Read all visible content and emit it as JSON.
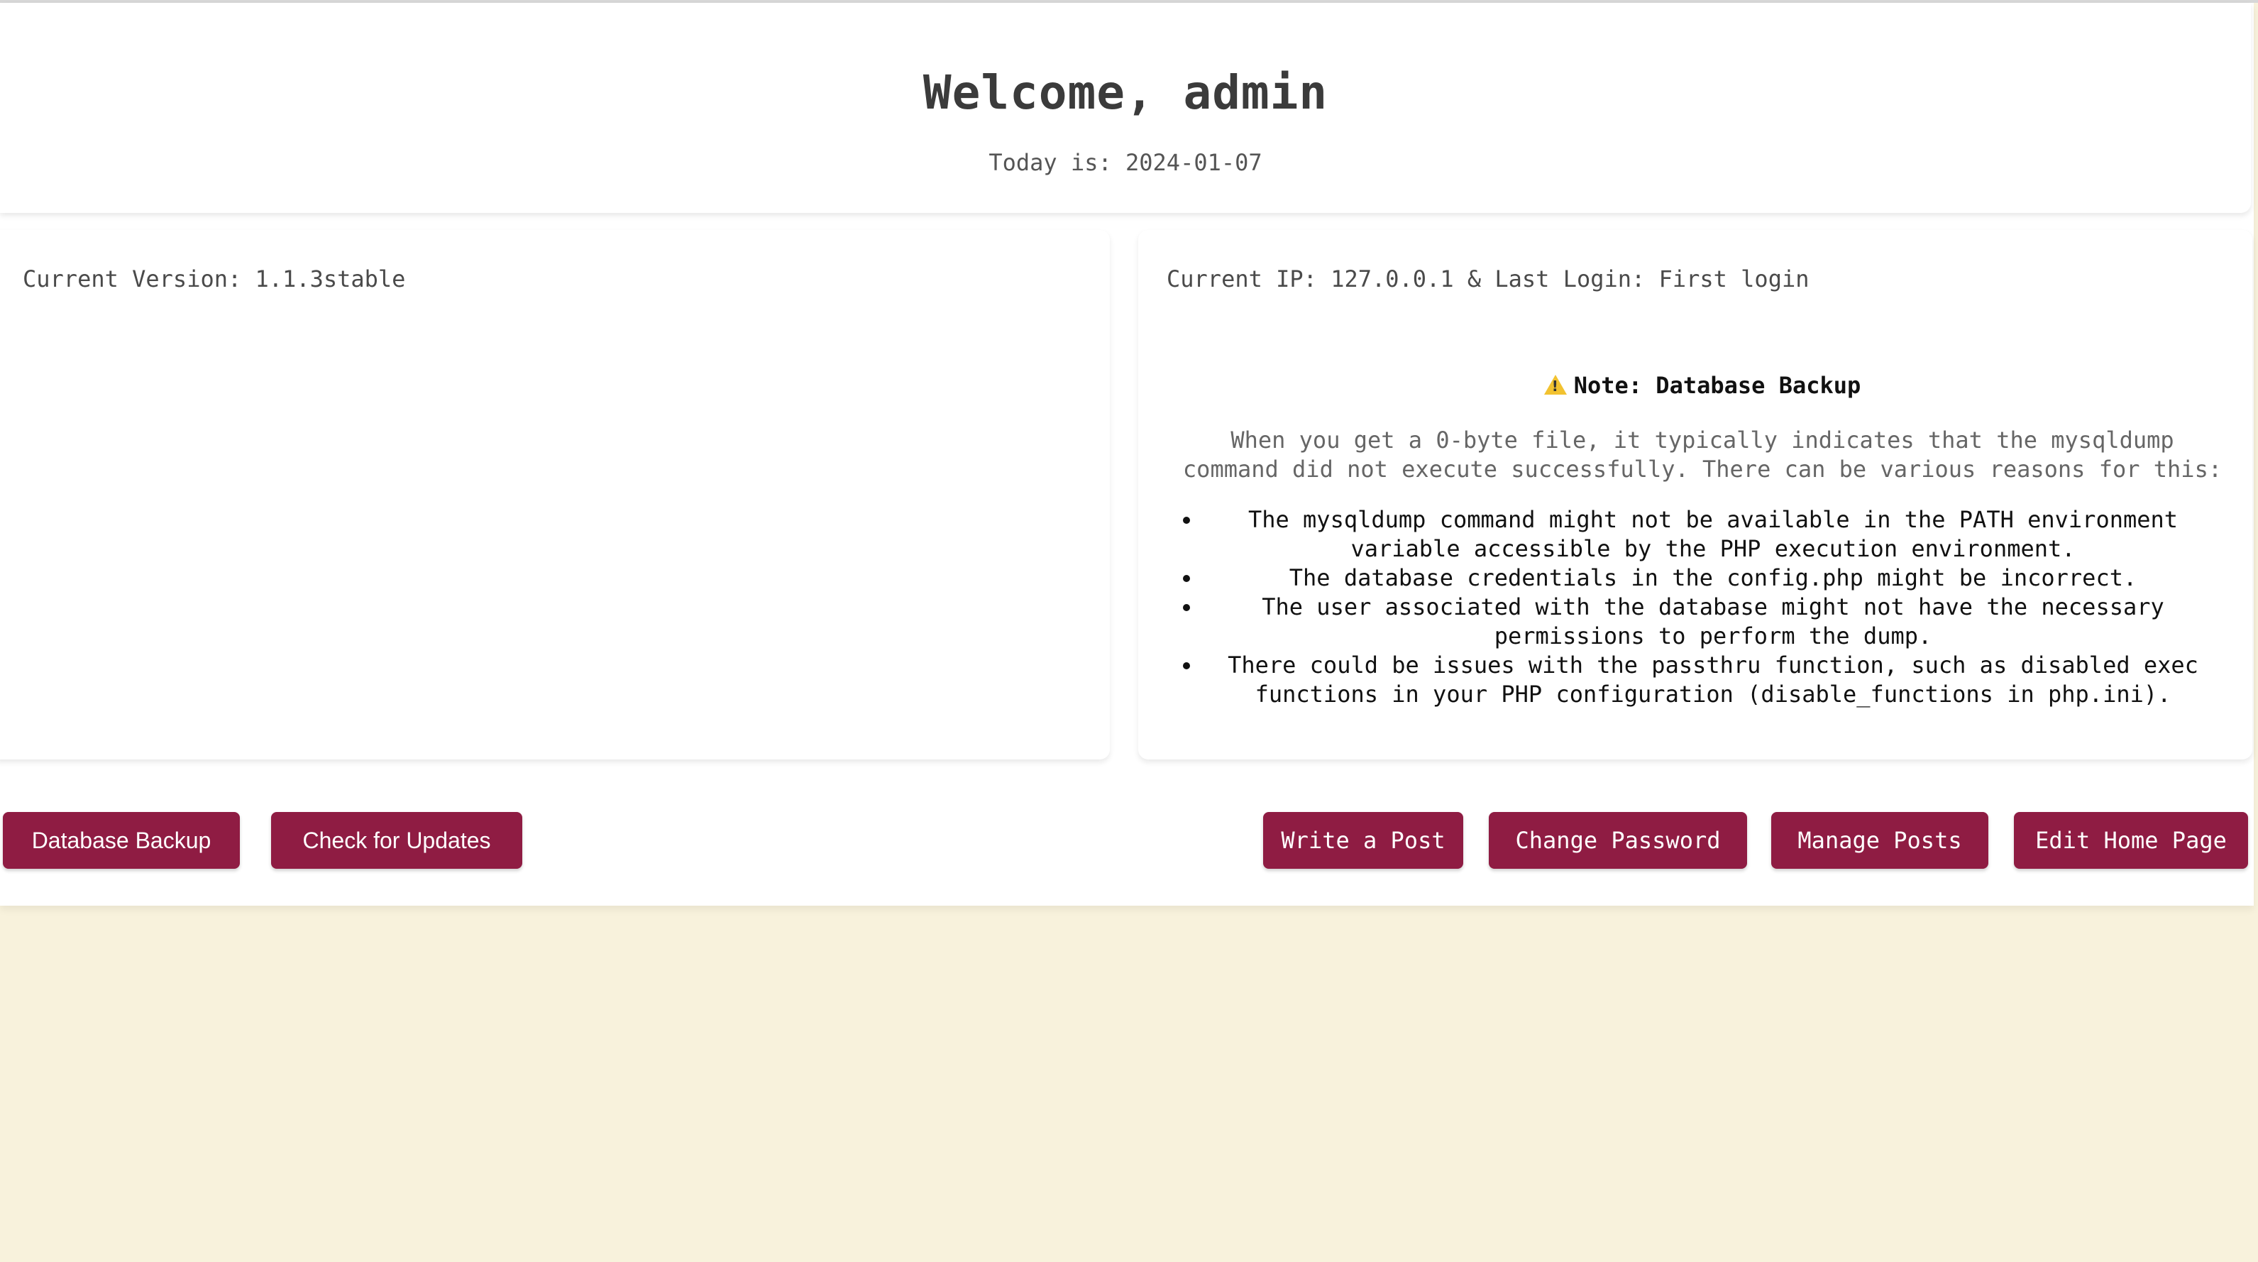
{
  "header": {
    "welcome": "Welcome, admin",
    "today": "Today is: 2024-01-07"
  },
  "left_panel": {
    "version": "Current Version: 1.1.3stable"
  },
  "right_panel": {
    "ip_login": "Current IP: 127.0.0.1 & Last Login: First login",
    "note": {
      "icon": "warning-icon",
      "title": "Note: Database Backup",
      "text": "When you get a 0-byte file, it typically indicates that the mysqldump command did not execute successfully. There can be various reasons for this:",
      "reasons": [
        "The mysqldump command might not be available in the PATH environment variable accessible by the PHP execution environment.",
        "The database credentials in the config.php might be incorrect.",
        "The user associated with the database might not have the necessary permissions to perform the dump.",
        "There could be issues with the passthru function, such as disabled exec functions in your PHP configuration (disable_functions in php.ini)."
      ]
    }
  },
  "actions": {
    "database_backup": "Database Backup",
    "check_updates": "Check for Updates",
    "write_post": "Write a Post",
    "change_password": "Change Password",
    "manage_posts": "Manage Posts",
    "edit_home_page": "Edit Home Page"
  },
  "colors": {
    "accent": "#8f1c43",
    "background": "#f8f2dc",
    "card": "#ffffff",
    "warning": "#f2c230"
  }
}
